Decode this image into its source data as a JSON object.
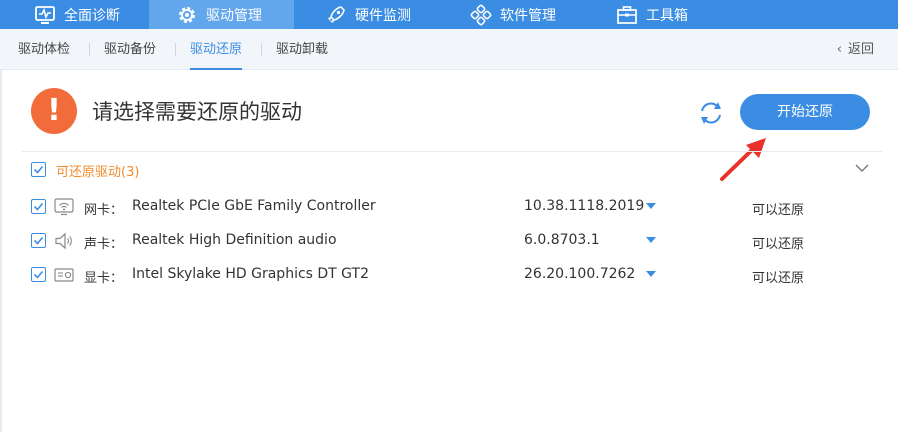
{
  "topnav": {
    "tabs": [
      {
        "label": "全面诊断",
        "icon": "monitor-pulse-icon"
      },
      {
        "label": "驱动管理",
        "icon": "gear-icon",
        "active": true
      },
      {
        "label": "硬件监测",
        "icon": "rocket-icon"
      },
      {
        "label": "软件管理",
        "icon": "grid-flower-icon"
      },
      {
        "label": "工具箱",
        "icon": "toolbox-icon"
      }
    ]
  },
  "subnav": {
    "tabs": [
      {
        "label": "驱动体检"
      },
      {
        "label": "驱动备份"
      },
      {
        "label": "驱动还原",
        "active": true
      },
      {
        "label": "驱动卸载"
      }
    ],
    "back_label": "返回"
  },
  "header": {
    "warning_glyph": "!",
    "title": "请选择需要还原的驱动",
    "restore_button_label": "开始还原"
  },
  "group": {
    "label": "可还原驱动(3)",
    "checked": true
  },
  "drivers": [
    {
      "type": "网卡：",
      "name": "Realtek PCIe GbE Family Controller",
      "version": "10.38.1118.2019",
      "status": "可以还原",
      "icon": "network-icon",
      "checked": true
    },
    {
      "type": "声卡：",
      "name": "Realtek High Definition audio",
      "version": "6.0.8703.1",
      "status": "可以还原",
      "icon": "speaker-icon",
      "checked": true
    },
    {
      "type": "显卡：",
      "name": "Intel Skylake HD Graphics DT GT2",
      "version": "26.20.100.7262",
      "status": "可以还原",
      "icon": "graphics-card-icon",
      "checked": true
    }
  ],
  "colors": {
    "accent": "#3b8de3",
    "warning": "#f26b3a",
    "group_label": "#f08c2e",
    "annotation_arrow": "#e8322b"
  }
}
